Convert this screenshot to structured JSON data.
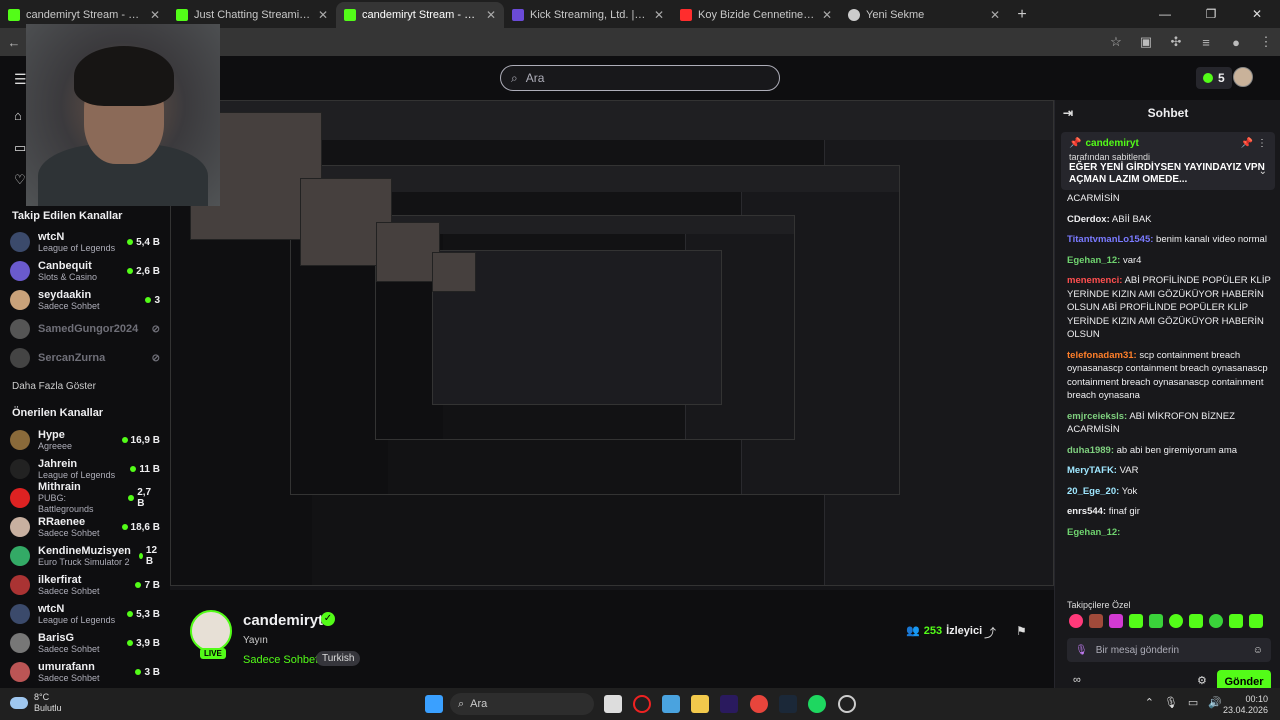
{
  "tabs": [
    {
      "title": "candemiryt Stream - Watch Live",
      "color": "#53fc18"
    },
    {
      "title": "Just Chatting Streaming - Live S",
      "color": "#53fc18"
    },
    {
      "title": "candemiryt Stream - Watch Live",
      "color": "#53fc18"
    },
    {
      "title": "Kick Streaming, Ltd. | Set up pay",
      "color": "#6b4bd8"
    },
    {
      "title": "Koy Bizide Cennetine | Abdurrah",
      "color": "#ff2d2d"
    },
    {
      "title": "Yeni Sekme",
      "color": "#cccccc"
    }
  ],
  "topnav": {
    "search_placeholder": "Ara",
    "kicks_count": "5"
  },
  "sidebar": {
    "followed_title": "Takip Edilen Kanallar",
    "followed": [
      {
        "name": "wtcN",
        "category": "League of Legends",
        "viewers": "5,4 B",
        "color": "#3b4a6b"
      },
      {
        "name": "Canbequit",
        "category": "Slots & Casino",
        "viewers": "2,6 B",
        "color": "#6a5acd"
      },
      {
        "name": "seydaakin",
        "category": "Sadece Sohbet",
        "viewers": "3",
        "color": "#c9a27a"
      },
      {
        "name": "SamedGungor2024",
        "category": "",
        "viewers": "",
        "color": "#555"
      },
      {
        "name": "SercanZurna",
        "category": "",
        "viewers": "",
        "color": "#444"
      }
    ],
    "more_label": "Daha Fazla Göster",
    "recommended_title": "Önerilen Kanallar",
    "recommended": [
      {
        "name": "Hype",
        "category": "Agreeee",
        "viewers": "16,9 B",
        "color": "#8a6a3a"
      },
      {
        "name": "Jahrein",
        "category": "League of Legends",
        "viewers": "11 B",
        "color": "#222"
      },
      {
        "name": "Mithrain",
        "category": "PUBG: Battlegrounds",
        "viewers": "2,7 B",
        "color": "#d22"
      },
      {
        "name": "RRaenee",
        "category": "Sadece Sohbet",
        "viewers": "18,6 B",
        "color": "#c8b0a0"
      },
      {
        "name": "KendineMuzisyen",
        "category": "Euro Truck Simulator 2",
        "viewers": "12 B",
        "color": "#3a6"
      },
      {
        "name": "ilkerfirat",
        "category": "Sadece Sohbet",
        "viewers": "7 B",
        "color": "#a33"
      },
      {
        "name": "wtcN",
        "category": "League of Legends",
        "viewers": "5,3 B",
        "color": "#3b4a6b"
      },
      {
        "name": "BarisG",
        "category": "Sadece Sohbet",
        "viewers": "3,9 B",
        "color": "#777"
      },
      {
        "name": "umurafann",
        "category": "Sadece Sohbet",
        "viewers": "3 B",
        "color": "#b55"
      }
    ]
  },
  "channel": {
    "name": "candemiryt",
    "subtitle": "Yayın",
    "category": "Sadece Sohbet",
    "tag": "Turkish",
    "viewers": "253",
    "viewers_label": "İzleyici",
    "live": "LIVE"
  },
  "chat": {
    "title": "Sohbet",
    "pinned_user": "candemiryt",
    "pinned_by": "tarafından sabitlendi",
    "pinned_msg": "EĞER YENİ GİRDİYSEN YAYINDAYIZ VPN AÇMAN LAZIM OMEDE...",
    "messages": [
      {
        "user": "",
        "text": "ACARMİSİN",
        "color": "#efeff1"
      },
      {
        "user": "CDerdox:",
        "text": "ABİİ BAK",
        "color": "#efeff1"
      },
      {
        "user": "TitantvmanLo1545:",
        "text": "benim kanalı video normal",
        "color": "#7a7aff"
      },
      {
        "user": "Egehan_12:",
        "text": "var4",
        "color": "#6fd36f"
      },
      {
        "user": "menemenci:",
        "text": "ABİ PROFİLİNDE POPÜLER KLİP YERİNDE KIZIN AMI GÖZÜKÜYOR HABERİN OLSUN ABİ PROFİLİNDE POPÜLER KLİP YERİNDE KIZIN AMI GÖZÜKÜYOR HABERİN OLSUN",
        "color": "#ff4f4f"
      },
      {
        "user": "telefonadam31:",
        "text": "scp containment breach oynasanascp containment breach oynasanascp containment breach oynasanascp containment breach oynasana",
        "color": "#ff7f2a"
      },
      {
        "user": "emjrceieksls:",
        "text": "ABİ MİKROFON BİZNEZ ACARMİSİN",
        "color": "#7fd07f"
      },
      {
        "user": "duha1989:",
        "text": "ab abi ben giremiyorum ama",
        "color": "#7fd07f"
      },
      {
        "user": "MeryTAFK:",
        "text": "VAR",
        "color": "#9fe7ff"
      },
      {
        "user": "20_Ege_20:",
        "text": "Yok",
        "color": "#9fe7ff"
      },
      {
        "user": "enrs544:",
        "text": "finaf gir",
        "color": "#efeff1"
      },
      {
        "user": "Egehan_12:",
        "text": "",
        "color": "#6fd36f"
      }
    ],
    "subs_label": "Takipçilere Özel",
    "input_placeholder": "Bir mesaj gönderin",
    "send_label": "Gönder"
  },
  "taskbar": {
    "temp": "8°C",
    "weather": "Bulutlu",
    "search": "Ara",
    "time": "00:10",
    "date": "23.04.2026"
  }
}
